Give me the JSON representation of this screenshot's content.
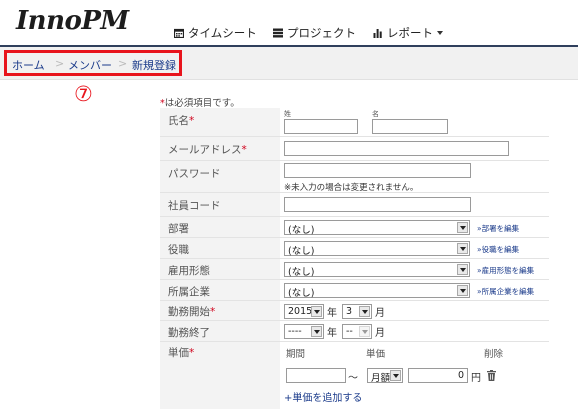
{
  "app": {
    "logo_inno": "Inno",
    "logo_pm": "PM"
  },
  "nav": {
    "timesheet": {
      "label": "タイムシート",
      "icon": "calendar-icon"
    },
    "project": {
      "label": "プロジェクト",
      "icon": "list-icon"
    },
    "report": {
      "label": "レポート",
      "icon": "bar-chart-icon"
    }
  },
  "breadcrumb": {
    "home": "ホーム",
    "members": "メンバー",
    "current": "新規登録",
    "separator": ">"
  },
  "annotation": {
    "marker": "⑦"
  },
  "form": {
    "required_note": {
      "star": "*",
      "text": "は必須項目です。"
    },
    "name": {
      "label": "氏名",
      "last_caption": "姓",
      "first_caption": "名",
      "last_value": "",
      "first_value": ""
    },
    "email": {
      "label": "メールアドレス",
      "value": ""
    },
    "password": {
      "label": "パスワード",
      "value": "",
      "hint": "※未入力の場合は変更されません。"
    },
    "employee_code": {
      "label": "社員コード",
      "value": ""
    },
    "department": {
      "label": "部署",
      "selected": "(なし)",
      "edit_link": "»部署を編集"
    },
    "position": {
      "label": "役職",
      "selected": "(なし)",
      "edit_link": "»役職を編集"
    },
    "employment_type": {
      "label": "雇用形態",
      "selected": "(なし)",
      "edit_link": "»雇用形態を編集"
    },
    "company": {
      "label": "所属企業",
      "selected": "(なし)",
      "edit_link": "»所属企業を編集"
    },
    "start": {
      "label": "勤務開始",
      "year": "2015",
      "year_unit": "年",
      "month": "3",
      "month_unit": "月"
    },
    "end": {
      "label": "勤務終了",
      "year": "----",
      "year_unit": "年",
      "month": "--",
      "month_unit": "月"
    },
    "unit_price": {
      "label": "単価",
      "col_period": "期間",
      "col_price": "単価",
      "col_delete": "削除",
      "tilde": "〜",
      "period_start": "",
      "basis": "月額",
      "amount": "0",
      "currency": "円",
      "add_link": "+単価を追加する"
    }
  },
  "colors": {
    "accent_red": "#e8141c",
    "link": "#1a3a8a",
    "header_rule": "#2f3f5c",
    "required": "#d0021b"
  }
}
